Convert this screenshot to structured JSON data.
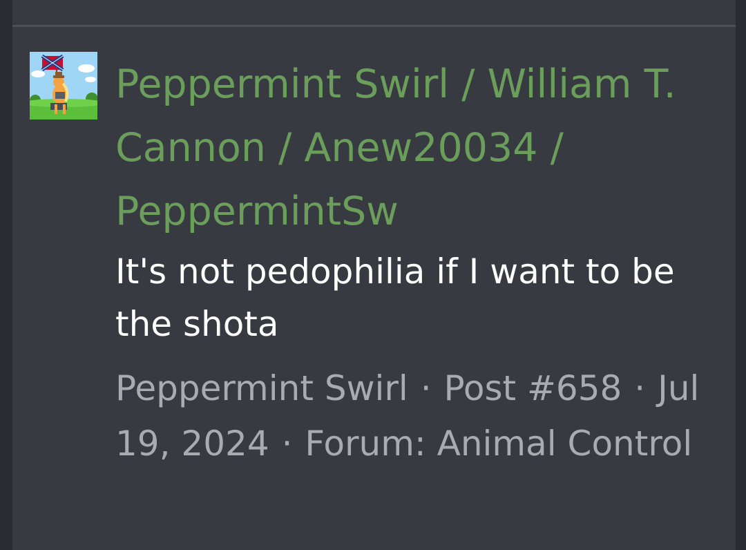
{
  "post": {
    "title": "Peppermint Swirl / William T. Cannon / Anew20034 / PeppermintSw",
    "body": "It's not pedophilia if I want to be the shota",
    "author": "Peppermint Swirl",
    "post_number": "Post #658",
    "date": "Jul 19, 2024",
    "forum": "Forum: Animal Control",
    "separator": "·",
    "avatar_icon": "pony-with-flag-avatar"
  },
  "colors": {
    "title": "#6a9e5a",
    "body": "#ffffff",
    "meta": "#a9abb0",
    "card_bg": "#383a41"
  }
}
